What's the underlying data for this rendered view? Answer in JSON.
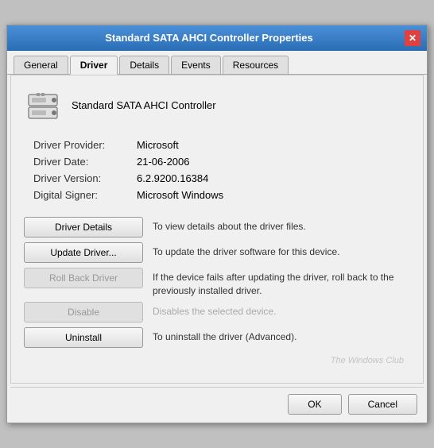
{
  "window": {
    "title": "Standard SATA AHCI Controller Properties",
    "close_label": "✕"
  },
  "tabs": [
    {
      "label": "General",
      "active": false
    },
    {
      "label": "Driver",
      "active": true
    },
    {
      "label": "Details",
      "active": false
    },
    {
      "label": "Events",
      "active": false
    },
    {
      "label": "Resources",
      "active": false
    }
  ],
  "device": {
    "name": "Standard SATA AHCI Controller"
  },
  "info": {
    "provider_label": "Driver Provider:",
    "provider_value": "Microsoft",
    "date_label": "Driver Date:",
    "date_value": "21-06-2006",
    "version_label": "Driver Version:",
    "version_value": "6.2.9200.16384",
    "signer_label": "Digital Signer:",
    "signer_value": "Microsoft Windows"
  },
  "buttons": [
    {
      "label": "Driver Details",
      "desc": "To view details about the driver files.",
      "disabled": false,
      "desc_disabled": false
    },
    {
      "label": "Update Driver...",
      "desc": "To update the driver software for this device.",
      "disabled": false,
      "desc_disabled": false
    },
    {
      "label": "Roll Back Driver",
      "desc": "If the device fails after updating the driver, roll back to the previously installed driver.",
      "disabled": true,
      "desc_disabled": false
    },
    {
      "label": "Disable",
      "desc": "Disables the selected device.",
      "disabled": true,
      "desc_disabled": true
    },
    {
      "label": "Uninstall",
      "desc": "To uninstall the driver (Advanced).",
      "disabled": false,
      "desc_disabled": false
    }
  ],
  "watermark": "The Windows Club",
  "footer": {
    "ok_label": "OK",
    "cancel_label": "Cancel"
  }
}
